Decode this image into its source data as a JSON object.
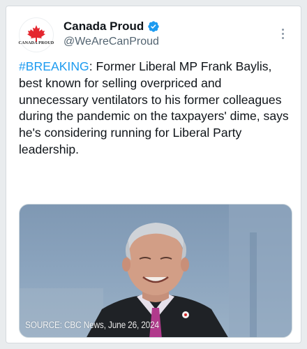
{
  "tweet": {
    "author": {
      "display_name": "Canada Proud",
      "handle": "@WeAreCanProud",
      "avatar_text": "CANADA PROUD",
      "verified": true,
      "avatar_icon": "maple-leaf-icon"
    },
    "text": {
      "hashtag": "#BREAKING",
      "body": ": Former Liberal MP Frank Baylis, best known for selling overpriced and unnecessary ventilators to his former colleagues during the pandemic on the taxpayers' dime, says he's considering running for Liberal Party leadership."
    },
    "media": {
      "caption": "SOURCE: CBC News, June 26, 2024"
    }
  },
  "colors": {
    "accent": "#1d9bf0",
    "text": "#0f1419",
    "muted": "#536471",
    "maple": "#e4262e"
  }
}
